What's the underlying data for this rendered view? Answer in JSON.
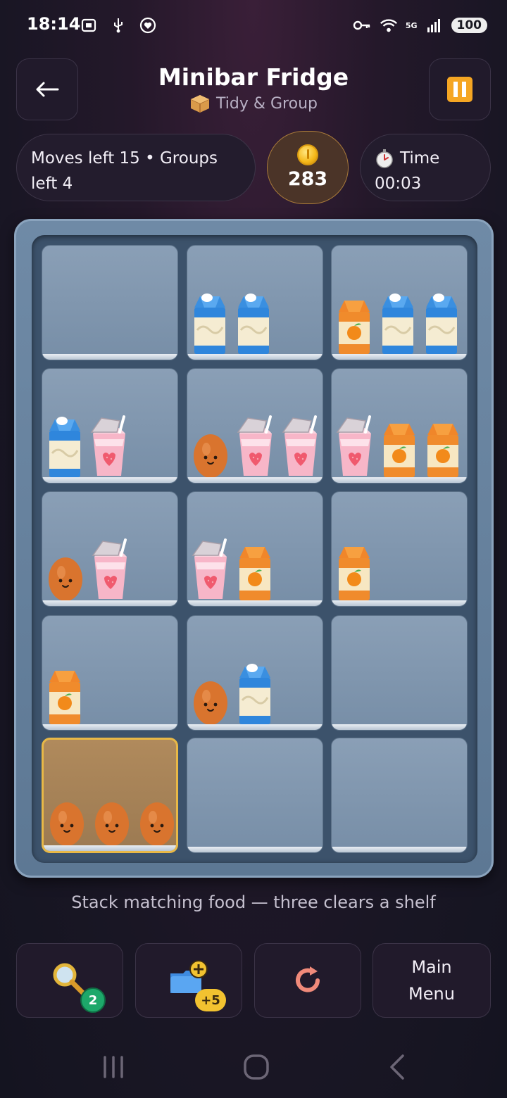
{
  "status_bar": {
    "time": "18:14",
    "battery": "100",
    "network": "5G",
    "icons": [
      "screenshot-icon",
      "usb-icon",
      "heart-icon",
      "key-icon",
      "wifi-icon",
      "signal-icon"
    ]
  },
  "header": {
    "title": "Minibar Fridge",
    "subtitle": "Tidy & Group",
    "subtitle_icon": "box-icon",
    "back_icon": "arrow-left-icon",
    "pause_icon": "pause-icon"
  },
  "stats": {
    "moves_text": "Moves left 15  •  Groups left 4",
    "coins": "283",
    "time_label": "Time",
    "time_value": "00:03"
  },
  "fridge": {
    "shelves": [
      {
        "row": 1,
        "col": 1,
        "items": []
      },
      {
        "row": 1,
        "col": 2,
        "items": [
          "milk",
          "milk"
        ]
      },
      {
        "row": 1,
        "col": 3,
        "items": [
          "juice",
          "milk",
          "milk"
        ]
      },
      {
        "row": 2,
        "col": 1,
        "items": [
          "milk",
          "yogurt"
        ]
      },
      {
        "row": 2,
        "col": 2,
        "items": [
          "egg",
          "yogurt",
          "yogurt"
        ]
      },
      {
        "row": 2,
        "col": 3,
        "items": [
          "yogurt",
          "juice",
          "juice"
        ]
      },
      {
        "row": 3,
        "col": 1,
        "items": [
          "egg",
          "yogurt"
        ]
      },
      {
        "row": 3,
        "col": 2,
        "items": [
          "yogurt",
          "juice"
        ]
      },
      {
        "row": 3,
        "col": 3,
        "items": [
          "juice"
        ]
      },
      {
        "row": 4,
        "col": 1,
        "items": [
          "juice"
        ]
      },
      {
        "row": 4,
        "col": 2,
        "items": [
          "egg",
          "milk"
        ]
      },
      {
        "row": 4,
        "col": 3,
        "items": []
      },
      {
        "row": 5,
        "col": 1,
        "items": [
          "egg",
          "egg",
          "egg"
        ],
        "selected": true
      },
      {
        "row": 5,
        "col": 2,
        "items": []
      },
      {
        "row": 5,
        "col": 3,
        "items": []
      }
    ]
  },
  "hint": "Stack matching food — three clears a shelf",
  "toolbar": {
    "search_badge": "2",
    "add_badge": "+5",
    "menu_label": "Main Menu"
  },
  "colors": {
    "background": "#191624",
    "selected_shelf": "#e8b847",
    "coin": "#f5b819",
    "pause": "#f5a623"
  }
}
